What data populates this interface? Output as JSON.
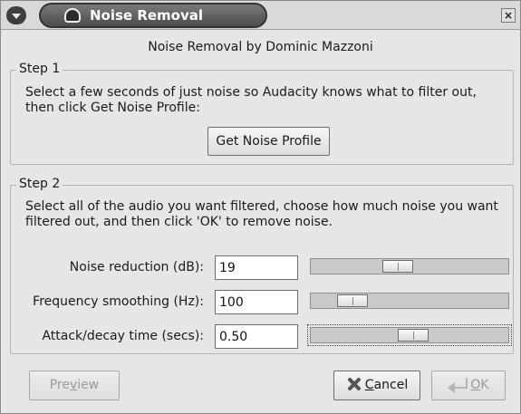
{
  "window": {
    "title": "Noise Removal",
    "close_glyph": "×"
  },
  "dialog": {
    "heading": "Noise Removal by Dominic Mazzoni"
  },
  "step1": {
    "legend": "Step 1",
    "description_line1": "Select a few seconds of just noise so Audacity knows what to filter out,",
    "description_line2": "then click Get Noise Profile:",
    "button_label": "Get Noise Profile"
  },
  "step2": {
    "legend": "Step 2",
    "description_line1": "Select all of the audio you want filtered, choose how much noise you want",
    "description_line2": "filtered out, and then click 'OK' to remove noise.",
    "fields": [
      {
        "label": "Noise reduction (dB):",
        "value": "19",
        "slider_fraction": 0.43
      },
      {
        "label": "Frequency smoothing (Hz):",
        "value": "100",
        "slider_fraction": 0.16
      },
      {
        "label": "Attack/decay time (secs):",
        "value": "0.50",
        "slider_fraction": 0.52
      }
    ]
  },
  "footer": {
    "preview": {
      "prefix": "Pre",
      "key": "v",
      "suffix": "iew"
    },
    "cancel": {
      "key": "C",
      "suffix": "ancel"
    },
    "ok": {
      "key": "O",
      "suffix": "K"
    }
  },
  "colors": {
    "dialog_background": "#e6e6e6",
    "title_pill": "#4c4c4c",
    "disabled_text": "#9a9a9a"
  },
  "icons": {
    "menu": "chevron-down-icon",
    "title": "headphones-icon",
    "close": "close-icon",
    "cancel": "cancel-x-icon",
    "ok": "return-arrow-icon"
  }
}
